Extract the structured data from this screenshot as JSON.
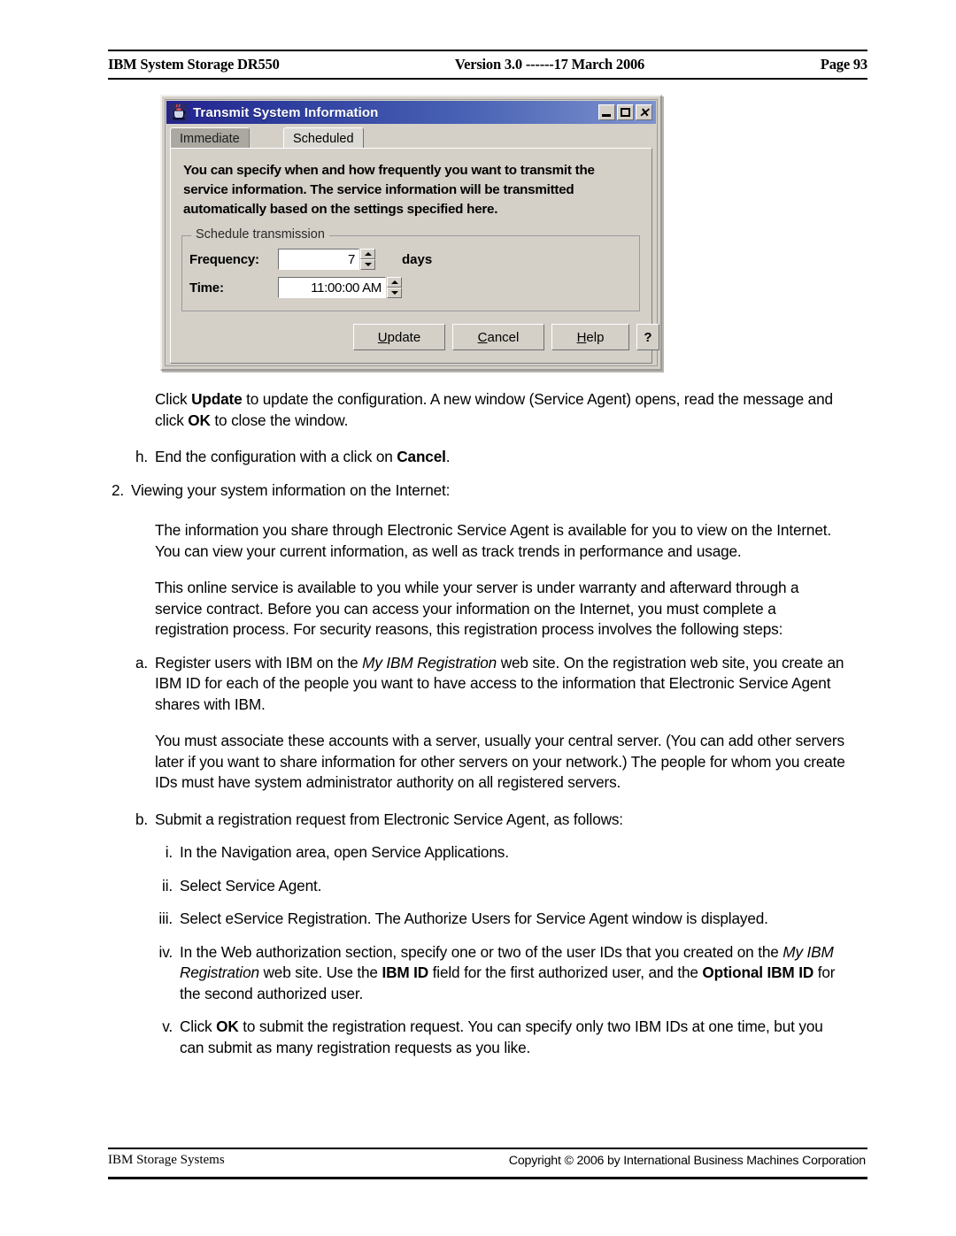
{
  "header": {
    "left": "IBM System Storage DR550",
    "middle": "Version 3.0 ------17 March 2006",
    "right": "Page 93"
  },
  "dialog": {
    "title": "Transmit System Information",
    "icon": "java-coffee-cup-icon",
    "window_controls": {
      "minimize": "minimize-icon",
      "maximize": "maximize-icon",
      "close": "close-icon"
    },
    "tabs": [
      {
        "label": "Immediate",
        "selected": false
      },
      {
        "label": "Scheduled",
        "selected": true
      }
    ],
    "description": "You can specify when and how frequently you want to transmit the service information.  The service information will be transmitted automatically based on the settings specified here.",
    "group": {
      "legend": "Schedule transmission",
      "fields": [
        {
          "label": "Frequency:",
          "value": "7",
          "suffix": "days"
        },
        {
          "label": "Time:",
          "value": "11:00:00 AM",
          "suffix": ""
        }
      ]
    },
    "buttons": [
      {
        "mnemonic": "U",
        "rest": "pdate"
      },
      {
        "mnemonic": "C",
        "rest": "ancel"
      },
      {
        "mnemonic": "H",
        "rest": "elp"
      }
    ],
    "help_button": "?"
  },
  "body": {
    "p_update": {
      "t1": "Click ",
      "b1": "Update",
      "t2": " to update the configuration. A new window (Service Agent) opens, read the message and click ",
      "b2": "OK",
      "t3": " to close the window."
    },
    "item_h": {
      "marker": "h.",
      "t1": "End the configuration with a click on ",
      "b1": "Cancel",
      "t2": "."
    },
    "item_2": {
      "marker": "2.",
      "text": "Viewing your system information on the Internet:"
    },
    "p_internet": "The information you share through Electronic Service Agent is available for you to view on the Internet. You can view your current information, as well as track trends in performance and usage.",
    "p_online": "This online service is available to you while your server is under warranty and afterward through a service contract. Before you can access your information on the Internet, you must complete a registration process. For security reasons, this registration process involves the following steps:",
    "item_a": {
      "marker": "a.",
      "t1": "Register users with IBM on the ",
      "i1": "My IBM Registration",
      "t2": " web site. On the registration web site, you create an IBM ID for each of the people you want to have access to the information that Electronic Service Agent shares with IBM."
    },
    "p_associate": "You must associate these accounts with a server, usually your central server. (You can add other servers later if you want to share information for other servers on your network.) The people for whom you create IDs must have system administrator authority on all registered servers.",
    "item_b": {
      "marker": "b.",
      "text": "Submit a registration request from Electronic Service Agent, as follows:"
    },
    "item_i": {
      "marker": "i.",
      "text": "In the Navigation area, open Service Applications."
    },
    "item_ii": {
      "marker": "ii.",
      "text": "Select Service Agent."
    },
    "item_iii": {
      "marker": "iii.",
      "text": "Select eService Registration. The Authorize Users for Service Agent window is displayed."
    },
    "item_iv": {
      "marker": "iv.",
      "t1": "In the Web authorization section, specify one or two of the user IDs that you created on the ",
      "i1": "My IBM Registration",
      "t2": " web site. Use the ",
      "b1": "IBM ID",
      "t3": " field for the first authorized user, and the ",
      "b2": "Optional IBM ID",
      "t4": " for the second authorized user."
    },
    "item_v": {
      "marker": "v.",
      "t1": "Click ",
      "b1": "OK",
      "t2": " to submit the registration request. You can specify only two IBM IDs at one time, but you can submit as many registration requests as you like."
    }
  },
  "footer": {
    "left": "IBM Storage Systems",
    "right": "Copyright © 2006 by International Business Machines Corporation"
  }
}
